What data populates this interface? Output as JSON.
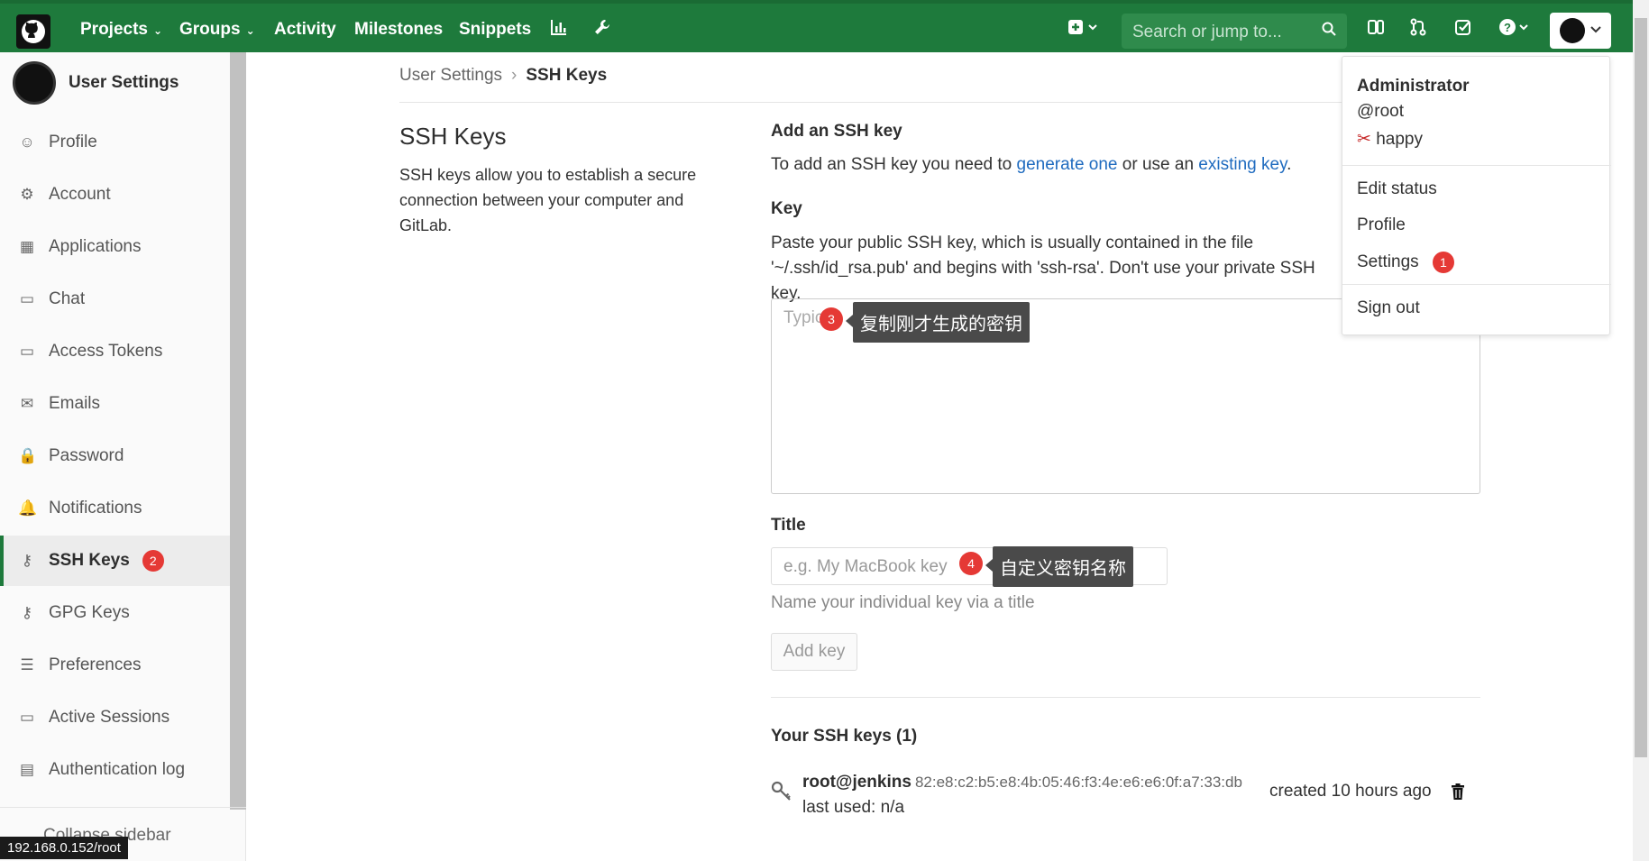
{
  "topnav": {
    "items": [
      {
        "label": "Projects",
        "caret": "⌄"
      },
      {
        "label": "Groups",
        "caret": "⌄"
      },
      {
        "label": "Activity"
      },
      {
        "label": "Milestones"
      },
      {
        "label": "Snippets"
      }
    ],
    "search_placeholder": "Search or jump to...",
    "icons": [
      "chart-icon",
      "wrench-icon",
      "plus-square-icon",
      "todos-icon",
      "merge-request-icon",
      "check-icon",
      "help-icon"
    ]
  },
  "sidebar": {
    "title": "User Settings",
    "items": [
      {
        "label": "Profile",
        "icon": "☺"
      },
      {
        "label": "Account",
        "icon": "⚙"
      },
      {
        "label": "Applications",
        "icon": "▦"
      },
      {
        "label": "Chat",
        "icon": "▭"
      },
      {
        "label": "Access Tokens",
        "icon": "▭"
      },
      {
        "label": "Emails",
        "icon": "✉"
      },
      {
        "label": "Password",
        "icon": "🔒"
      },
      {
        "label": "Notifications",
        "icon": "🔔"
      },
      {
        "label": "SSH Keys",
        "icon": "⚷",
        "badge": "2"
      },
      {
        "label": "GPG Keys",
        "icon": "⚷"
      },
      {
        "label": "Preferences",
        "icon": "☰"
      },
      {
        "label": "Active Sessions",
        "icon": "▭"
      },
      {
        "label": "Authentication log",
        "icon": "▤"
      }
    ],
    "collapse": "Collapse sidebar"
  },
  "url_status": "192.168.0.152/root",
  "breadcrumb": {
    "parent": "User Settings",
    "sep": "›",
    "current": "SSH Keys"
  },
  "left": {
    "heading": "SSH Keys",
    "description": "SSH keys allow you to establish a secure connection between your computer and GitLab."
  },
  "form": {
    "add_heading": "Add an SSH key",
    "intro_pre": "To add an SSH key you need to ",
    "link1": "generate one",
    "intro_mid": " or use an ",
    "link2": "existing key",
    "intro_end": ".",
    "key_label": "Key",
    "key_desc": "Paste your public SSH key, which is usually contained in the file '~/.ssh/id_rsa.pub' and begins with 'ssh-rsa'. Don't use your private SSH key.",
    "key_placeholder": "Typic",
    "title_label": "Title",
    "title_placeholder": "e.g. My MacBook key",
    "title_hint": "Name your individual key via a title",
    "add_button": "Add key"
  },
  "annotations": {
    "one": "1",
    "two": "2",
    "three": "3",
    "four": "4",
    "tip3": "复制刚才生成的密钥",
    "tip4": "自定义密钥名称"
  },
  "keys": {
    "heading": "Your SSH keys (1)",
    "rows": [
      {
        "name": "root@jenkins",
        "fingerprint": "82:e8:c2:b5:e8:4b:05:46:f3:4e:e6:e6:0f:a7:33:db",
        "last_used": "last used: n/a",
        "created": "created 10 hours ago"
      }
    ]
  },
  "dropdown": {
    "name": "Administrator",
    "username": "@root",
    "status_emoji": "✂",
    "status": "happy",
    "items": [
      "Edit status",
      "Profile",
      "Settings",
      "Sign out"
    ]
  },
  "colors": {
    "nav": "#1e7a3c",
    "accent": "#e53935",
    "link": "#1f6bbf"
  }
}
